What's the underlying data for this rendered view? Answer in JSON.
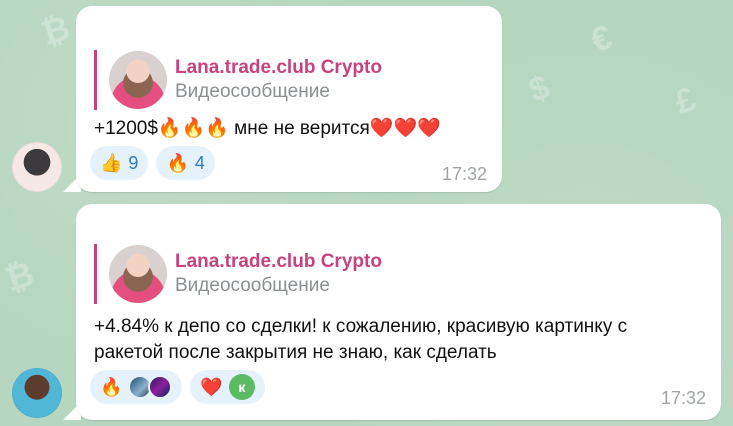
{
  "messages": [
    {
      "reply": {
        "title": "Lana.trade.club Crypto",
        "subtitle": "Видеосообщение"
      },
      "text": "+1200$🔥🔥🔥 мне не верится❤️❤️❤️",
      "reactions": [
        {
          "emoji": "👍",
          "count": "9"
        },
        {
          "emoji": "🔥",
          "count": "4"
        }
      ],
      "time": "17:32"
    },
    {
      "reply": {
        "title": "Lana.trade.club Crypto",
        "subtitle": "Видеосообщение"
      },
      "text_line1": "+4.84% к депо со сделки! к сожалению, красивую картинку с",
      "text_line2": "ракетой после закрытия не знаю, как сделать",
      "reactions": [
        {
          "emoji": "🔥"
        },
        {
          "emoji": "❤️",
          "avatar_letter": "к"
        }
      ],
      "time": "17:32"
    }
  ],
  "colors": {
    "background": "#b6d6bf",
    "bubble": "#ffffff",
    "reply_accent": "#c8437d",
    "reaction_bg": "#e6f2fb",
    "reaction_text": "#2f7bbd",
    "time_text": "#a0a4a9"
  }
}
